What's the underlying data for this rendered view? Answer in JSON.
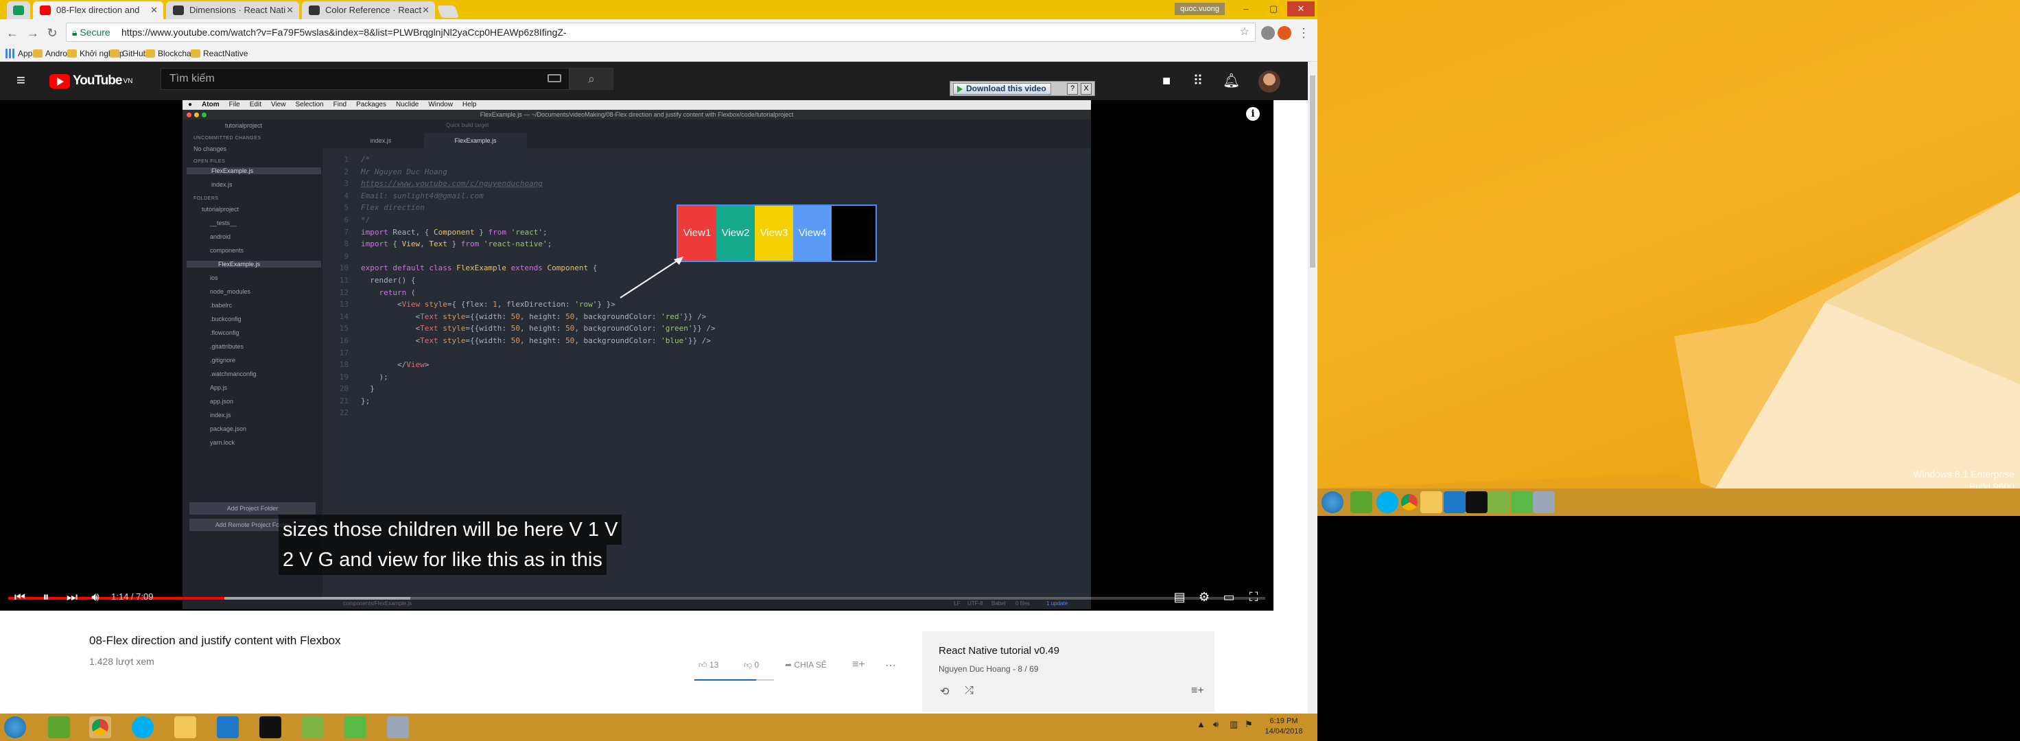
{
  "browser": {
    "tabs": [
      {
        "title": "08-Flex direction and",
        "active": true
      },
      {
        "title": "Dimensions · React Nati"
      },
      {
        "title": "Color Reference · React"
      }
    ],
    "profile_name": "quoc.vuong",
    "secure_label": "Secure",
    "url": "https://www.youtube.com/watch?v=Fa79F5wslas&index=8&list=PLWBrqglnjNl2yaCcp0HEAWp6z8IfingZ-",
    "bookmarks": [
      "Apps",
      "Android",
      "Khởi nghiệp",
      "GitHub",
      "Blockchain",
      "ReactNative"
    ]
  },
  "youtube": {
    "logo_text": "YouTube",
    "logo_region": "VN",
    "search_placeholder": "Tìm kiếm",
    "download_label": "Download this video",
    "download_help": "?",
    "download_close": "X"
  },
  "video": {
    "mac_menu": [
      "Atom",
      "File",
      "Edit",
      "View",
      "Selection",
      "Find",
      "Packages",
      "Nuclide",
      "Window",
      "Help"
    ],
    "window_title": "FlexExample.js — ~/Documents/videoMaking/08-Flex direction and justify content with Flexbox/code/tutorialproject",
    "tree": {
      "project": "tutorialproject",
      "uncommitted_header": "UNCOMMITTED CHANGES",
      "no_changes": "No changes",
      "open_files_header": "OPEN FILES",
      "open_files": [
        "FlexExample.js",
        "index.js"
      ],
      "folders_header": "FOLDERS",
      "items": [
        "tutorialproject",
        "__tests__",
        "android",
        "components",
        "FlexExample.js",
        "ios",
        "node_modules",
        ".babelrc",
        ".buckconfig",
        ".flowconfig",
        ".gitattributes",
        ".gitignore",
        ".watchmanconfig",
        "App.js",
        "app.json",
        "index.js",
        "package.json",
        "yarn.lock"
      ],
      "add_project": "Add Project Folder",
      "add_remote": "Add Remote Project Folder"
    },
    "toolbar_placeholder": "Quick build target",
    "editor_tabs": [
      "index.js",
      "FlexExample.js"
    ],
    "status_text": "components/FlexExample.js",
    "status_right": [
      "LF",
      "UTF-8",
      "Babel",
      "0 files",
      "1 update"
    ],
    "demo_views": [
      {
        "label": "View1",
        "color": "#f03b3b"
      },
      {
        "label": "View2",
        "color": "#13a98a"
      },
      {
        "label": "View3",
        "color": "#f5d000"
      },
      {
        "label": "View4",
        "color": "#5a9cf5"
      }
    ],
    "captions": [
      "sizes those children will be here V 1 V",
      "2 V G and view for like this as in this"
    ]
  },
  "player": {
    "current_time": "1:14",
    "duration": "7:09",
    "time_display": "1:14 / 7:09",
    "progress": 0.172,
    "buffered": 0.32
  },
  "page": {
    "title": "08-Flex direction and justify content with Flexbox",
    "views": "1.428 lượt xem",
    "likes": "13",
    "dislikes": "0",
    "share_label": "CHIA SẺ",
    "playlist_title": "React Native tutorial v0.49",
    "playlist_owner": "Nguyen Duc Hoang",
    "playlist_position": "- 8 / 69"
  },
  "taskbar": {
    "time": "6:19 PM",
    "date": "14/04/2018"
  },
  "desktop": {
    "watermark_line1": "Windows 8.1 Enterprise",
    "watermark_line2": "Build 9600"
  }
}
